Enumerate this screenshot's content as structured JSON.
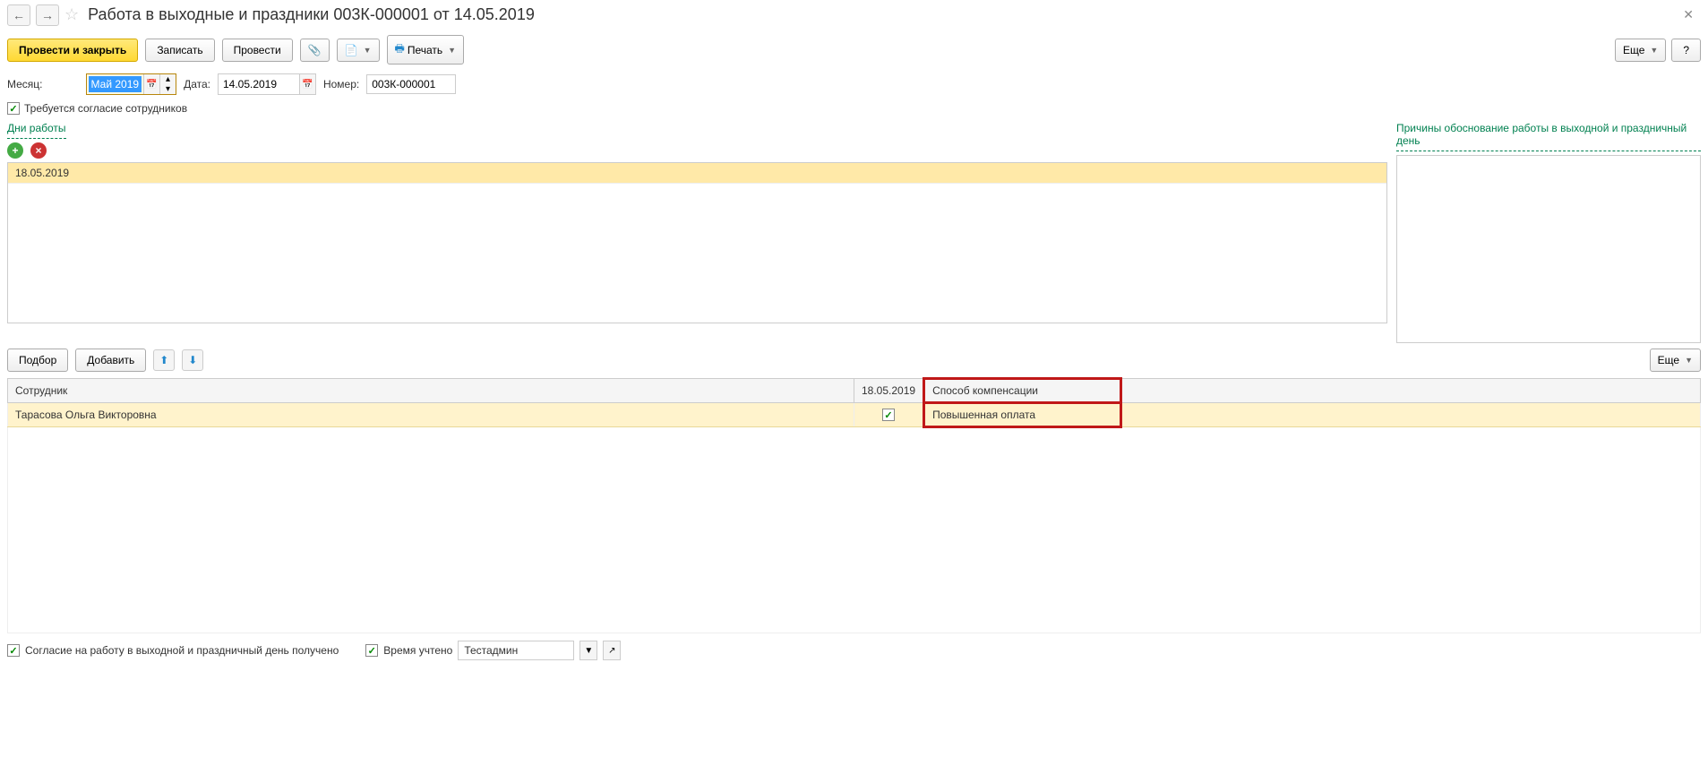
{
  "header": {
    "title": "Работа в выходные и праздники 003К-000001 от 14.05.2019"
  },
  "toolbar": {
    "post_close": "Провести и закрыть",
    "save": "Записать",
    "post": "Провести",
    "print": "Печать",
    "more": "Еще",
    "help": "?"
  },
  "form": {
    "month_label": "Месяц:",
    "month_value": "Май 2019",
    "date_label": "Дата:",
    "date_value": "14.05.2019",
    "number_label": "Номер:",
    "number_value": "003К-000001",
    "consent_label": "Требуется согласие сотрудников"
  },
  "days": {
    "title": "Дни работы",
    "items": [
      "18.05.2019"
    ]
  },
  "reasons": {
    "title": "Причины обоснование работы в выходной и праздничный день"
  },
  "table_toolbar": {
    "select": "Подбор",
    "add": "Добавить",
    "more": "Еще"
  },
  "table": {
    "headers": {
      "employee": "Сотрудник",
      "date": "18.05.2019",
      "compensation": "Способ компенсации"
    },
    "rows": [
      {
        "employee": "Тарасова Ольга Викторовна",
        "checked": true,
        "compensation": "Повышенная оплата"
      }
    ]
  },
  "footer": {
    "consent_received": "Согласие на работу в выходной и праздничный день получено",
    "time_recorded": "Время учтено",
    "admin": "Тестадмин"
  }
}
